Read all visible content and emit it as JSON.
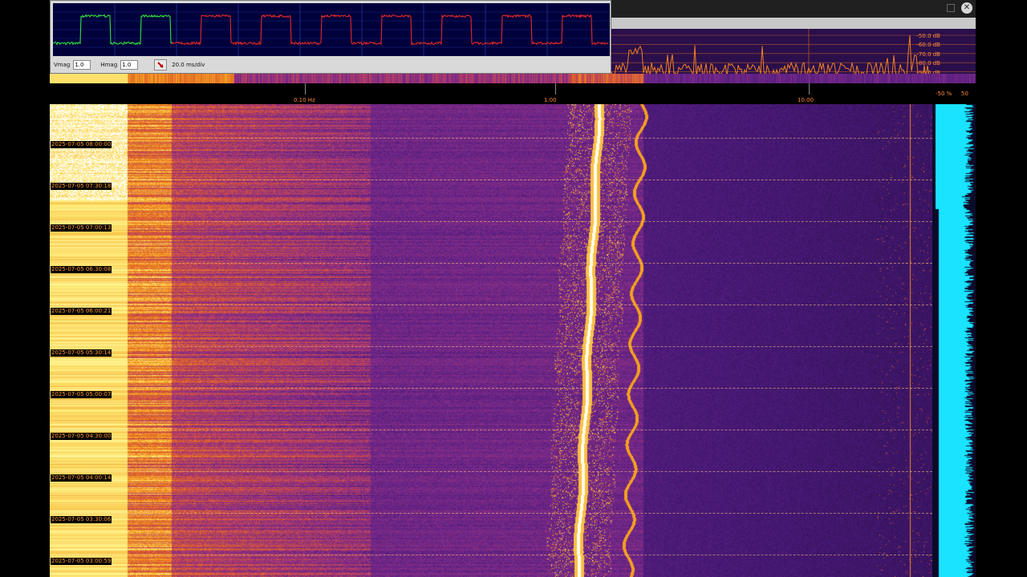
{
  "scope": {
    "vmag_label": "Vmag",
    "vmag_value": "1.0",
    "hmag_label": "Hmag",
    "hmag_value": "1.0",
    "timebase": "20.0 ms/div",
    "trigger_icon": "trigger-icon"
  },
  "window": {
    "maximize_icon": "maximize-icon",
    "close_icon": "close-icon",
    "close_glyph": "✕"
  },
  "spectrum": {
    "db_labels": [
      "-50.0 dB",
      "-60.0 dB",
      "-70.0 dB",
      "-80.0 dB",
      "-90.0 dB"
    ]
  },
  "freq_axis": {
    "labels": [
      "0.10 Hz",
      "1.00",
      "10.00"
    ],
    "side_labels": [
      "-50 %",
      "50"
    ]
  },
  "waterfall": {
    "timestamps": [
      "2025-07-05 08:00:00",
      "2025-07-05 07:30:18",
      "2025-07-05 07:00:13",
      "2025-07-05 06:30:08",
      "2025-07-05 06:00:21",
      "2025-07-05 05:30:14",
      "2025-07-05 05:00:07",
      "2025-07-05 04:30:00",
      "2025-07-05 04:00:14",
      "2025-07-05 03:30:06",
      "2025-07-05 03:00:59"
    ]
  },
  "colors": {
    "palette": [
      "#0a0620",
      "#2a0f4a",
      "#4a1a7a",
      "#7a2a8a",
      "#b03a6a",
      "#e0602a",
      "#f5a020",
      "#fff080",
      "#ffffff"
    ],
    "scope_green": "#30e040",
    "scope_red": "#e02828",
    "meter_cyan": "#19e3ff",
    "label_orange": "#ff8a3a"
  }
}
